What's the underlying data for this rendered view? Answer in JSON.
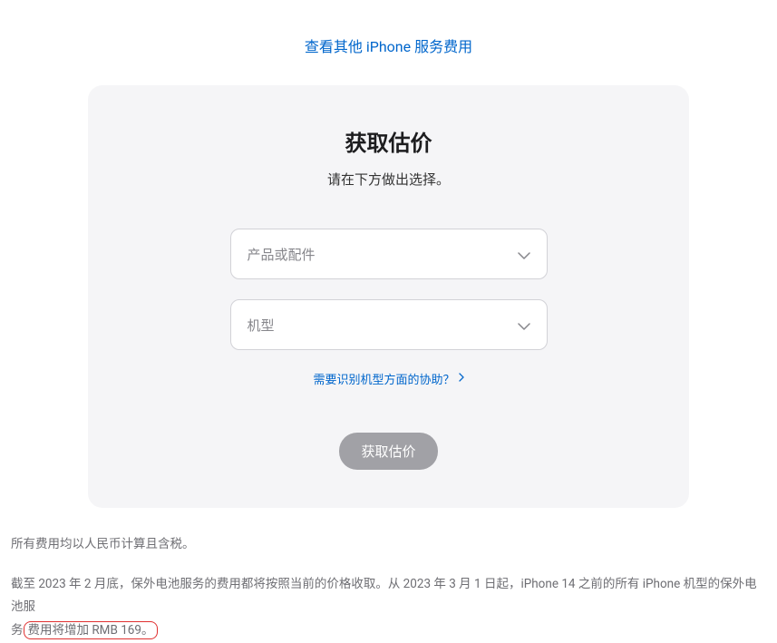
{
  "topLink": "查看其他 iPhone 服务费用",
  "card": {
    "title": "获取估价",
    "subtitle": "请在下方做出选择。",
    "select1": {
      "placeholder": "产品或配件"
    },
    "select2": {
      "placeholder": "机型"
    },
    "helpLink": "需要识别机型方面的协助？",
    "submitButton": "获取估价"
  },
  "footer": {
    "para1": "所有费用均以人民币计算且含税。",
    "para2_part1": "截至 2023 年 2 月底，保外电池服务的费用都将按照当前的价格收取。从 2023 年 3 月 1 日起，iPhone 14 之前的所有 iPhone 机型的保外电池服",
    "para2_part2": "务",
    "para2_highlight": "费用将增加 RMB 169。"
  }
}
